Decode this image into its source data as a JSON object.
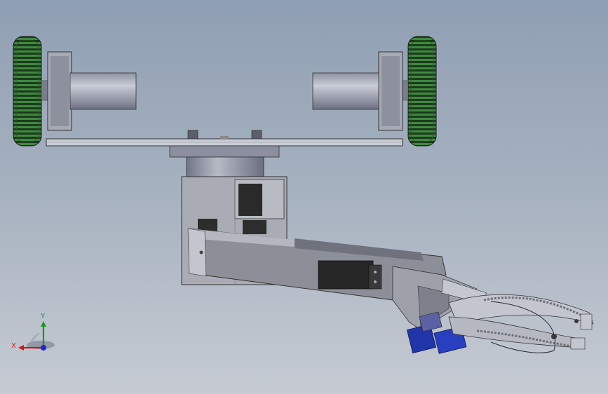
{
  "viewport": {
    "background_top": "#8f9fb3",
    "background_bottom": "#c6cbd3"
  },
  "triad": {
    "x_label": "X",
    "y_label": "Y",
    "x_color": "#d01818",
    "y_color": "#1a9a1a",
    "z_color": "#1a2ad0"
  },
  "colors": {
    "wheel_tread": "#2f6b2f",
    "wheel_dark": "#1d3a1d",
    "metal_light": "#cfd2d8",
    "metal_mid": "#9a9da6",
    "metal_dark": "#555862",
    "servo_body": "#2a2a2a",
    "servo_blue": "#1f35a8",
    "gripper": "#b9bcc4"
  }
}
